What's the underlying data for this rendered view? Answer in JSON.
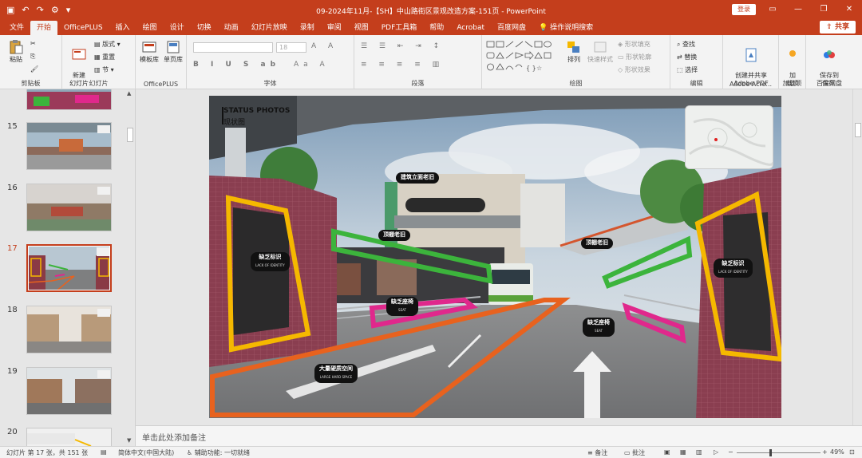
{
  "titlebar": {
    "title": "09-2024年11月-【SH】中山路街区景观改造方案-151页 - PowerPoint",
    "login": "登录",
    "accent": "#c43e1c"
  },
  "tabs": [
    "文件",
    "开始",
    "OfficePLUS",
    "插入",
    "绘图",
    "设计",
    "切换",
    "动画",
    "幻灯片放映",
    "录制",
    "审阅",
    "视图",
    "PDF工具箱",
    "帮助",
    "Acrobat",
    "百度网盘"
  ],
  "active_tab": "开始",
  "tell_me": "操作说明搜索",
  "share": "共享",
  "ribbon": {
    "clipboard": {
      "paste": "粘贴",
      "label": "剪贴板"
    },
    "slides": {
      "new_slide": "新建\n幻灯片",
      "layout": "版式",
      "reset": "重置",
      "section": "节",
      "label": "幻灯片"
    },
    "officeplus": {
      "template": "模板库",
      "single_page": "单页库",
      "label": "OfficePLUS"
    },
    "font": {
      "label": "字体",
      "size_value": "18"
    },
    "paragraph": {
      "label": "段落"
    },
    "drawing": {
      "arrange": "排列",
      "quick_styles": "快速样式",
      "shape_fill": "形状填充",
      "shape_outline": "形状轮廓",
      "shape_effects": "形状效果",
      "label": "绘图"
    },
    "editing": {
      "find": "查找",
      "replace": "替换",
      "select": "选择",
      "label": "编辑"
    },
    "adobe": {
      "create": "创建并共享\nAdobe PDF",
      "label": "Adobe Acro..."
    },
    "addins": {
      "add": "加\n载项",
      "label": "加载项"
    },
    "save": {
      "baidu": "保存到\n百度网盘",
      "label": "保存"
    }
  },
  "thumbnails": [
    {
      "num": "15",
      "selected": false
    },
    {
      "num": "16",
      "selected": false
    },
    {
      "num": "17",
      "selected": true
    },
    {
      "num": "18",
      "selected": false
    },
    {
      "num": "19",
      "selected": false
    },
    {
      "num": "20",
      "selected": false
    }
  ],
  "slide": {
    "title_en": "STATUS PHOTOS",
    "title_cn": "现状图",
    "callouts": [
      {
        "text": "建筑立面老旧",
        "sub": ""
      },
      {
        "text": "顶棚老旧",
        "sub": ""
      },
      {
        "text": "缺乏标识",
        "sub": "LACK OF IDENTITY"
      },
      {
        "text": "缺乏座椅",
        "sub": "SEAT"
      },
      {
        "text": "大量硬质空间",
        "sub": "LARGE HARD SPACE"
      },
      {
        "text": "顶棚老旧",
        "sub": ""
      },
      {
        "text": "缺乏标识",
        "sub": "LACK OF IDENTITY"
      },
      {
        "text": "缺乏座椅",
        "sub": "SEAT"
      }
    ],
    "highlight_colors": {
      "yellow": "#f5b800",
      "green": "#3cb43c",
      "magenta": "#e0288c",
      "orange": "#e8621e"
    }
  },
  "notes_placeholder": "单击此处添加备注",
  "status": {
    "slide_info": "幻灯片 第 17 张，共 151 张",
    "language": "简体中文(中国大陆)",
    "accessibility": "辅助功能: 一切就绪",
    "notes": "备注",
    "comments": "批注",
    "zoom": "49%"
  }
}
